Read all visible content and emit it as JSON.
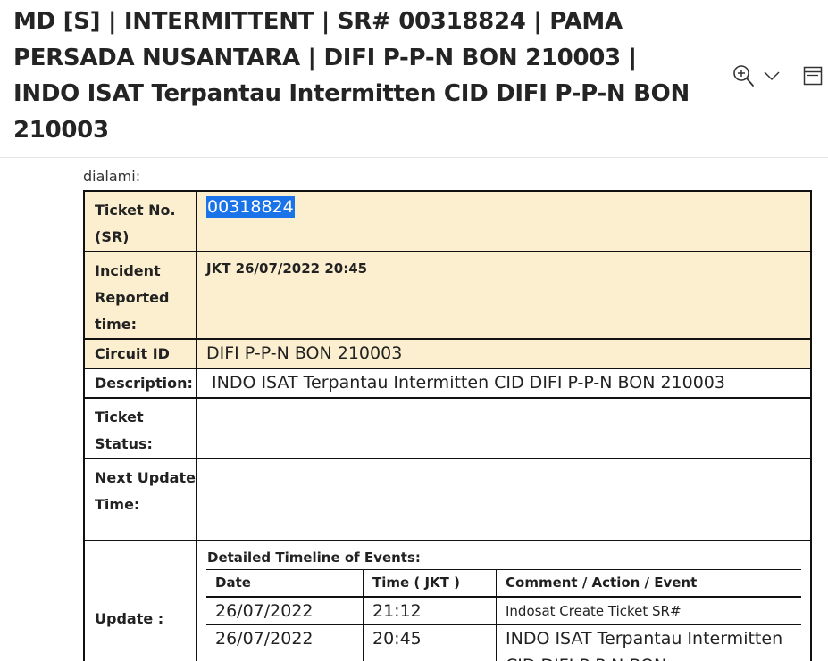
{
  "header": {
    "subject": "MD [S] | INTERMITTENT | SR# 00318824 | PAMA PERSADA NUSANTARA | DIFI P-P-N BON 210003 | INDO ISAT Terpantau Intermitten CID DIFI P-P-N BON 210003",
    "icons": [
      "zoom-in-icon",
      "chevron-down-icon",
      "reading-pane-icon"
    ]
  },
  "body": {
    "intro": "dialami:",
    "fields": {
      "ticket_no_label": "Ticket No. (SR)",
      "ticket_no_value": "00318824",
      "incident_label": "Incident Reported time:",
      "incident_value": "JKT 26/07/2022 20:45",
      "circuit_label": "Circuit ID",
      "circuit_value": "DIFI P-P-N BON 210003",
      "description_label": "Description:",
      "description_value": "INDO ISAT Terpantau Intermitten CID DIFI P-P-N BON 210003",
      "status_label": "Ticket Status:",
      "status_value": "",
      "next_update_label": "Next Update Time:",
      "next_update_value": "",
      "update_label": "Update :"
    },
    "timeline": {
      "title": "Detailed Timeline of Events:",
      "columns": [
        "Date",
        "Time ( JKT )",
        "Comment / Action / Event"
      ],
      "rows": [
        {
          "date": "26/07/2022",
          "time": "21:12",
          "comment": "Indosat Create Ticket SR#"
        },
        {
          "date": "26/07/2022",
          "time": "20:45",
          "comment": "INDO ISAT Terpantau Intermitten CID DIFI P-P-N BON"
        }
      ]
    }
  },
  "colors": {
    "highlight_row": "#fcefcf",
    "selection": "#1a73e8"
  }
}
